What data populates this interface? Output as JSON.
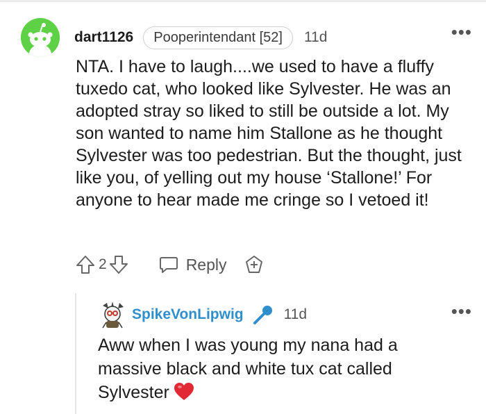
{
  "comment": {
    "username": "dart1126",
    "flair": "Pooperintendant [52]",
    "time": "11d",
    "more_label": "•••",
    "avatar_color": "#5fd146",
    "body": "NTA. I have to laugh....we used to have a fluffy tuxedo cat, who looked like Sylvester. He was an adopted stray so liked to still be outside a lot. My son wanted to name him Stallone as he thought Sylvester was too pedestrian. But the thought, just like you, of yelling out my house ‘Stallone!’ For anyone to hear made me cringe so I vetoed it!",
    "vote_count": "2",
    "reply_label": "Reply",
    "icons": [
      "upvote-icon",
      "downvote-icon",
      "reply-bubble-icon",
      "award-icon"
    ]
  },
  "reply": {
    "username": "SpikeVonLipwig",
    "username_color": "#2f8ecc",
    "time": "11d",
    "more_label": "•••",
    "body": "Aww when I was young my nana had a massive black and white tux cat called Sylvester",
    "icons": [
      "microphone-icon",
      "heart-emoji-icon"
    ]
  }
}
